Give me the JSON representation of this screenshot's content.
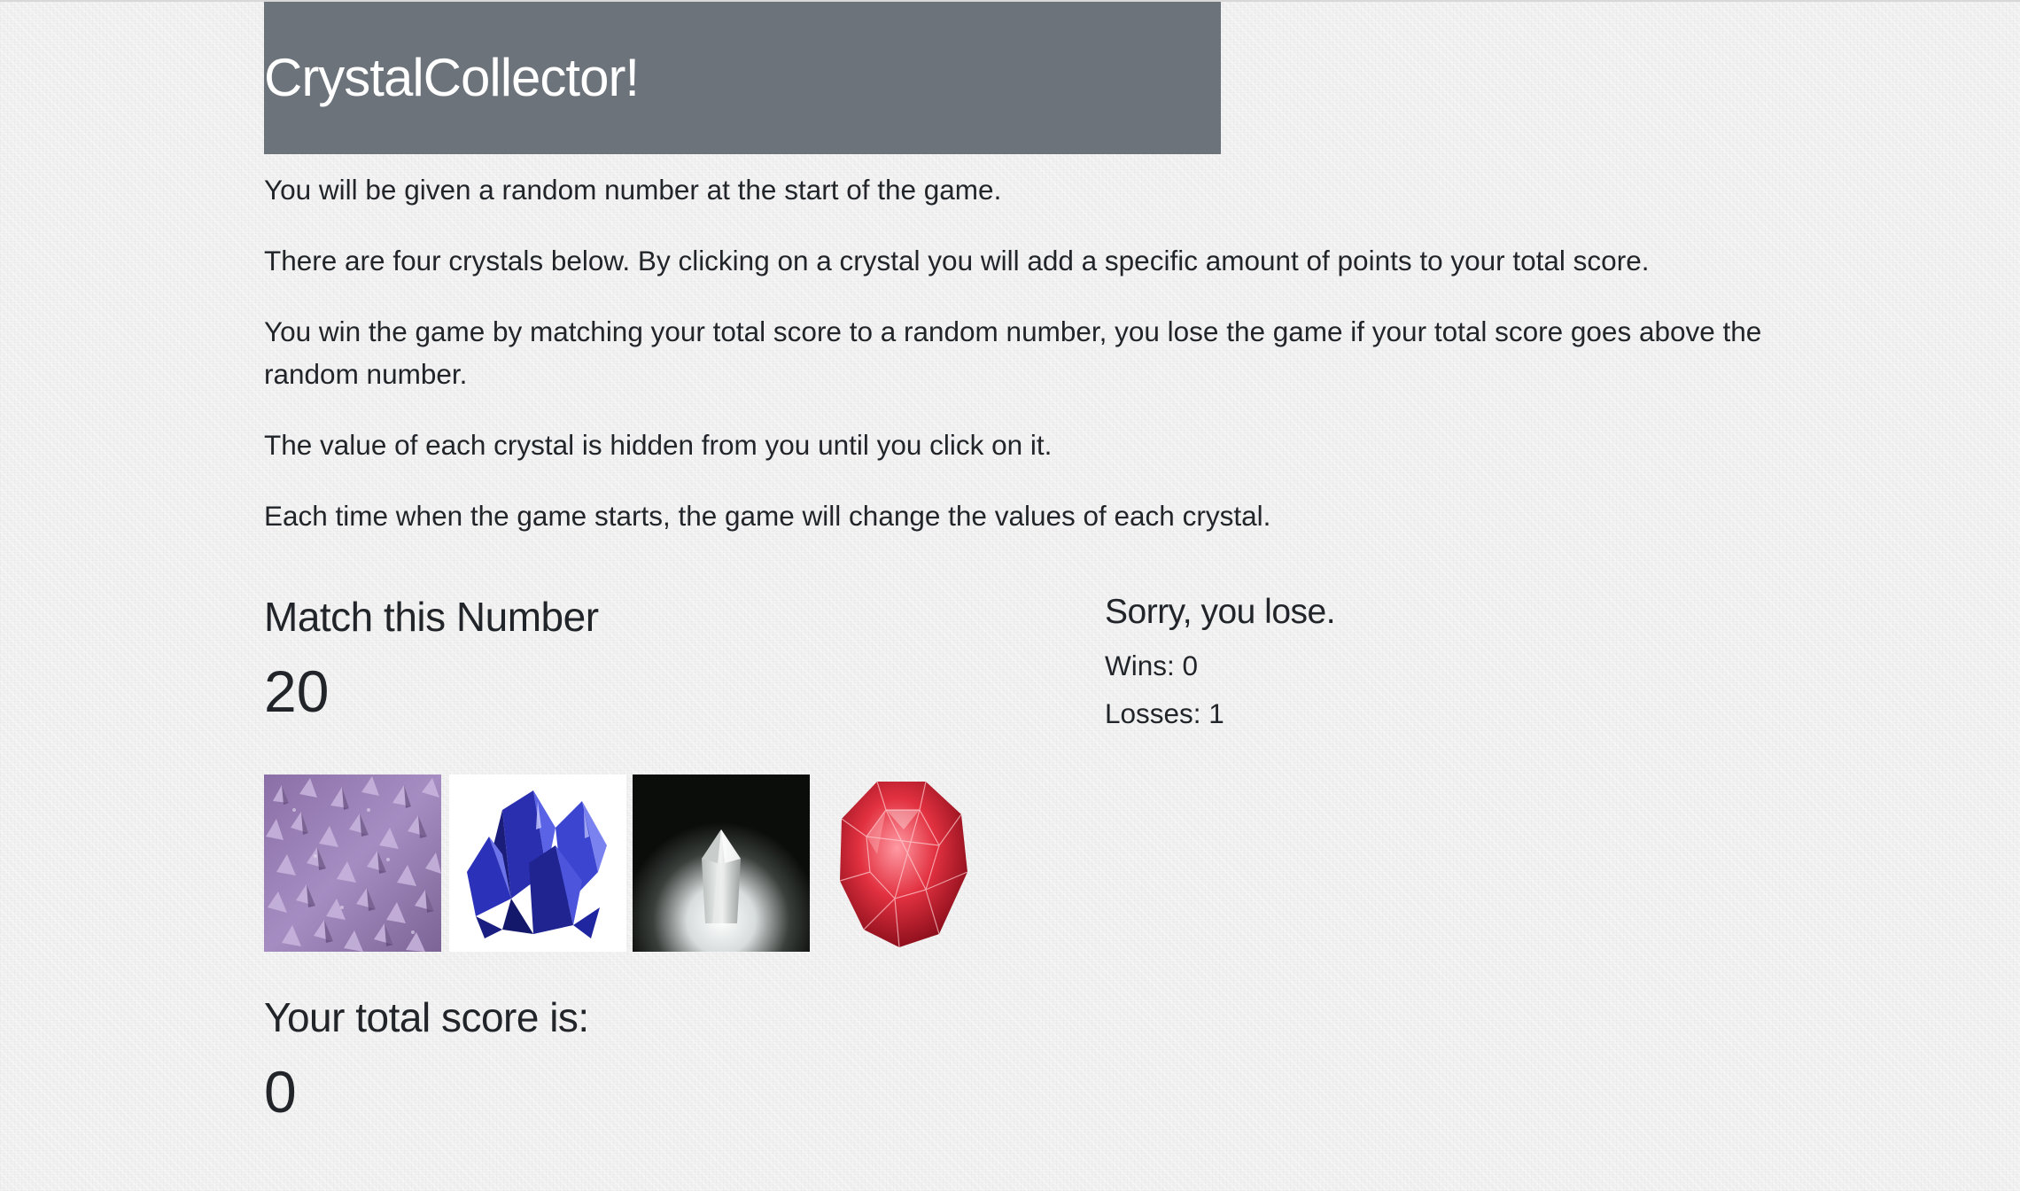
{
  "header": {
    "title": "CrystalCollector!",
    "bg_color": "#6c737b"
  },
  "instructions": [
    "You will be given a random number at the start of the game.",
    "There are four crystals below. By clicking on a crystal you will add a specific amount of points to your total score.",
    "You win the game by matching your total score to a random number, you lose the game if your total score goes above the random number.",
    "The value of each crystal is hidden from you until you click on it.",
    "Each time when the game starts, the game will change the values of each crystal."
  ],
  "target": {
    "label": "Match this Number",
    "value": "20"
  },
  "result": {
    "message": "Sorry, you lose.",
    "wins": "Wins: 0",
    "losses": "Losses: 1"
  },
  "crystals": [
    {
      "name": "amethyst-crystal",
      "icon": "purple-amethyst-cluster"
    },
    {
      "name": "sapphire-crystal",
      "icon": "blue-crystal-cluster"
    },
    {
      "name": "quartz-crystal",
      "icon": "clear-quartz-point"
    },
    {
      "name": "ruby-crystal",
      "icon": "red-faceted-gem"
    }
  ],
  "score": {
    "label": "Your total score is:",
    "value": "0"
  }
}
